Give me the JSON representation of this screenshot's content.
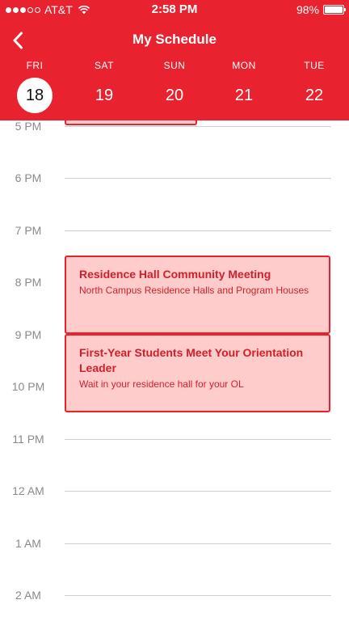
{
  "status_bar": {
    "carrier": "AT&T",
    "time": "2:58 PM",
    "battery": "98%",
    "battery_level": 0.98,
    "signal_bars": 3,
    "signal_total": 5
  },
  "nav": {
    "back_icon": "chevron-left-icon",
    "title": "My Schedule"
  },
  "days": [
    {
      "name": "FRI",
      "num": "18",
      "selected": true
    },
    {
      "name": "SAT",
      "num": "19",
      "selected": false
    },
    {
      "name": "SUN",
      "num": "20",
      "selected": false
    },
    {
      "name": "MON",
      "num": "21",
      "selected": false
    },
    {
      "name": "TUE",
      "num": "22",
      "selected": false
    }
  ],
  "hours": [
    "5 PM",
    "6 PM",
    "7 PM",
    "8 PM",
    "9 PM",
    "10 PM",
    "11 PM",
    "12 AM",
    "1 AM",
    "2 AM"
  ],
  "events": [
    {
      "title": "Residence Hall Community Meeting",
      "location": "North Campus Residence Halls and Program Houses"
    },
    {
      "title": "First-Year Students Meet Your Orientation Leader",
      "location": "Wait in your residence hall for your OL"
    }
  ],
  "colors": {
    "accent": "#e8222f",
    "event_fill": "#ffcccc",
    "event_text": "#d11f2a",
    "hour_text": "#8a8a8a",
    "grid_line": "#cfcfcf"
  }
}
